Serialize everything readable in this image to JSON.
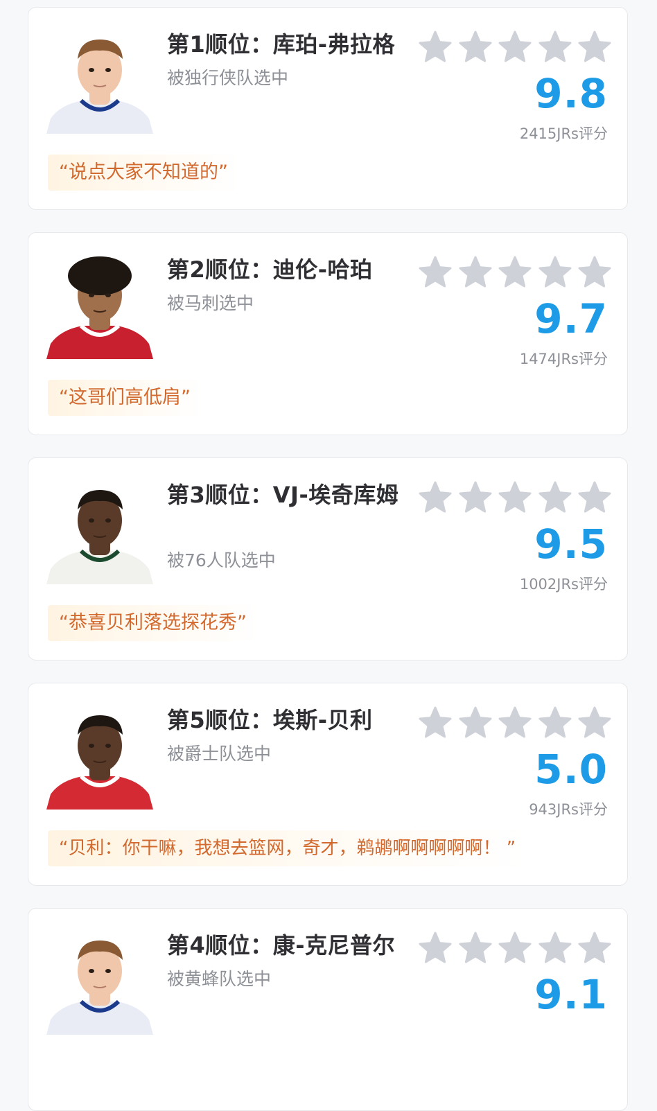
{
  "picks": [
    {
      "title": "第1顺位：库珀-弗拉格",
      "subtitle": "被独行侠队选中",
      "score": "9.8",
      "count": "2415JRs评分",
      "quote": "“说点大家不知道的”",
      "jersey": "#e9ecf5",
      "trim": "#1b3a8c"
    },
    {
      "title": "第2顺位：迪伦-哈珀",
      "subtitle": "被马刺选中",
      "score": "9.7",
      "count": "1474JRs评分",
      "quote": "“这哥们高低肩”",
      "jersey": "#c8202f",
      "trim": "#ffffff"
    },
    {
      "title": "第3顺位：VJ-埃奇库姆",
      "subtitle": "被76人队选中",
      "score": "9.5",
      "count": "1002JRs评分",
      "quote": "“恭喜贝利落选探花秀”",
      "jersey": "#f1f2ee",
      "trim": "#1c4a2f"
    },
    {
      "title": "第5顺位：埃斯-贝利",
      "subtitle": "被爵士队选中",
      "score": "5.0",
      "count": "943JRs评分",
      "quote": "“贝利：你干嘛，我想去篮网，奇才，鹈鹕啊啊啊啊啊！ ”",
      "jersey": "#d42a33",
      "trim": "#ffffff"
    },
    {
      "title": "第4顺位：康-克尼普尔",
      "subtitle": "被黄蜂队选中",
      "score": "9.1",
      "count": "",
      "quote": "",
      "jersey": "#e9ecf5",
      "trim": "#1b3a8c"
    }
  ],
  "stars_per_row": 5,
  "colors": {
    "star": "#cfd1d8",
    "score": "#1e9be6",
    "quote_text": "#d2692e",
    "quote_bg": "#fff4e2"
  },
  "icons": {
    "star": "star-icon",
    "avatar": "player-avatar"
  }
}
